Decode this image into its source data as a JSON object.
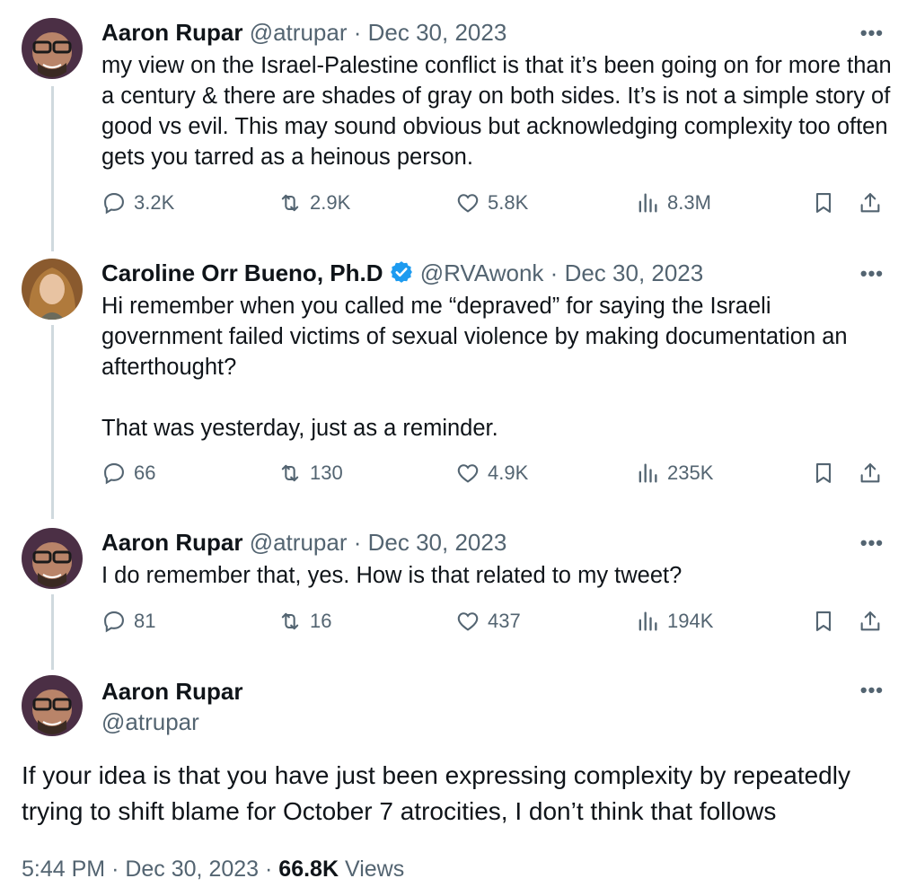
{
  "tweets": [
    {
      "name": "Aaron Rupar",
      "handle": "@atrupar",
      "sep": "·",
      "date": "Dec 30, 2023",
      "text": "my view on the Israel-Palestine conflict is that it’s been going on for more than a century & there are shades of gray on both sides. It’s is not a simple story of good vs evil. This may sound obvious but acknowledging complexity too often gets you tarred as a heinous person.",
      "replies": "3.2K",
      "reposts": "2.9K",
      "likes": "5.8K",
      "views": "8.3M"
    },
    {
      "name": "Caroline Orr Bueno, Ph.D",
      "handle": "@RVAwonk",
      "sep": "·",
      "date": "Dec 30, 2023",
      "text_p1": "Hi remember when you called me “depraved” for saying the Israeli government failed victims of sexual violence by making documentation an afterthought?",
      "text_p2": "That was yesterday, just as a reminder.",
      "replies": "66",
      "reposts": "130",
      "likes": "4.9K",
      "views": "235K"
    },
    {
      "name": "Aaron Rupar",
      "handle": "@atrupar",
      "sep": "·",
      "date": "Dec 30, 2023",
      "text": "I do remember that, yes. How is that related to my tweet?",
      "replies": "81",
      "reposts": "16",
      "likes": "437",
      "views": "194K"
    }
  ],
  "main": {
    "name": "Aaron Rupar",
    "handle": "@atrupar",
    "text": "If your idea is that you have just been expressing complexity by repeatedly trying to shift blame for October 7 atrocities, I don’t think that follows",
    "time": "5:44 PM",
    "sep": "·",
    "date": "Dec 30, 2023",
    "sep2": "·",
    "views_count": "66.8K",
    "views_label": "Views"
  },
  "more_label": "•••",
  "colors": {
    "accent": "#1d9bf0",
    "muted": "#536471",
    "text": "#0f1419",
    "line": "#cfd9de"
  }
}
